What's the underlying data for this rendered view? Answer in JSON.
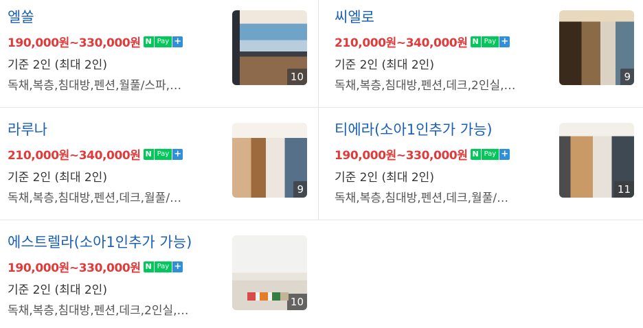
{
  "listings": [
    {
      "name": "엘쏠",
      "price": "190,000원~330,000원",
      "capacity": "기준 2인 (최대 2인)",
      "tags": "독채,복층,침대방,펜션,월풀/스파,…",
      "photo_count": "10"
    },
    {
      "name": "씨엘로",
      "price": "210,000원~340,000원",
      "capacity": "기준 2인 (최대 2인)",
      "tags": "독채,복층,침대방,펜션,데크,2인실,…",
      "photo_count": "9"
    },
    {
      "name": "라루나",
      "price": "210,000원~340,000원",
      "capacity": "기준 2인 (최대 2인)",
      "tags": "독채,복층,침대방,펜션,데크,월풀/…",
      "photo_count": "9"
    },
    {
      "name": "티에라(소아1인추가 가능)",
      "price": "190,000원~330,000원",
      "capacity": "기준 2인 (최대 2인)",
      "tags": "독채,복층,침대방,펜션,데크,월풀/…",
      "photo_count": "11"
    },
    {
      "name": "에스트렐라(소아1인추가 가능)",
      "price": "190,000원~330,000원",
      "capacity": "기준 2인 (최대 2인)",
      "tags": "독채,복층,침대방,펜션,데크,2인실,…",
      "photo_count": "10"
    }
  ],
  "npay": {
    "n": "N",
    "pay": "Pay",
    "plus": "+"
  },
  "colors": {
    "name": "#1a5fb4",
    "price": "#e03a3a",
    "npay_green": "#03c75a",
    "npay_blue": "#2f8fd8"
  }
}
